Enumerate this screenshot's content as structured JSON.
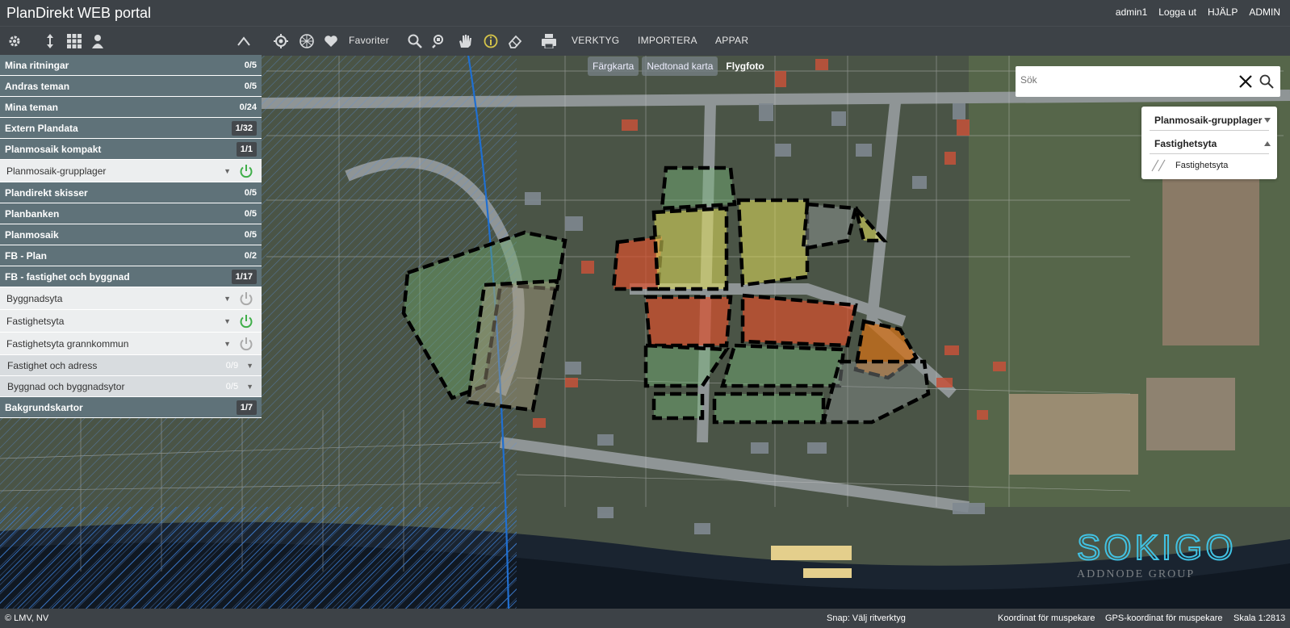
{
  "header": {
    "title": "PlanDirekt WEB portal",
    "links": [
      "admin1",
      "Logga ut",
      "HJÄLP",
      "ADMIN"
    ]
  },
  "toolbar": {
    "favoriter": "Favoriter",
    "verktyg": "VERKTYG",
    "importera": "IMPORTERA",
    "appar": "APPAR",
    "icons": [
      "gear-icon",
      "pan-icon",
      "grid-icon",
      "user-location-icon",
      "collapse-icon",
      "locate-icon",
      "globe-icon",
      "heart-icon",
      "search-icon",
      "search-map-icon",
      "hand-icon",
      "info-icon",
      "eraser-icon",
      "print-icon"
    ]
  },
  "map": {
    "tabs": [
      "Färgkarta",
      "Nedtonad karta",
      "Flygfoto"
    ],
    "active_tab": "Flygfoto",
    "search_placeholder": "Sök"
  },
  "layer_panel": {
    "group": "Planmosaik-grupplager",
    "layer": "Fastighetsyta",
    "legend": "Fastighetsyta"
  },
  "sidebar": {
    "rows": [
      {
        "label": "Mina ritningar",
        "count": "0/5",
        "kind": "dark"
      },
      {
        "label": "Andras teman",
        "count": "0/5",
        "kind": "dark"
      },
      {
        "label": "Mina teman",
        "count": "0/24",
        "kind": "dark"
      },
      {
        "label": "Extern Plandata",
        "count": "1/32",
        "kind": "dark-badge"
      },
      {
        "label": "Planmosaik kompakt",
        "count": "1/1",
        "kind": "dark-badge"
      },
      {
        "label": "Planmosaik-grupplager",
        "kind": "light",
        "power": "on"
      },
      {
        "label": "Plandirekt skisser",
        "count": "0/5",
        "kind": "dark"
      },
      {
        "label": "Planbanken",
        "count": "0/5",
        "kind": "dark"
      },
      {
        "label": "Planmosaik",
        "count": "0/5",
        "kind": "dark"
      },
      {
        "label": "FB - Plan",
        "count": "0/2",
        "kind": "dark"
      },
      {
        "label": "FB - fastighet och byggnad",
        "count": "1/17",
        "kind": "dark-badge"
      },
      {
        "label": "Byggnadsyta",
        "kind": "light",
        "power": "off"
      },
      {
        "label": "Fastighetsyta",
        "kind": "light",
        "power": "on"
      },
      {
        "label": "Fastighetsyta grannkommun",
        "kind": "light",
        "power": "off"
      },
      {
        "label": "Fastighet och adress",
        "count": "0/9",
        "kind": "grey"
      },
      {
        "label": "Byggnad och byggnadsytor",
        "count": "0/5",
        "kind": "grey"
      },
      {
        "label": "Bakgrundskartor",
        "count": "1/7",
        "kind": "dark-badge"
      }
    ]
  },
  "status": {
    "attribution": "© LMV, NV",
    "snap": "Snap: Välj ritverktyg",
    "coord": "Koordinat för muspekare",
    "gps": "GPS-koordinat för muspekare",
    "scale": "Skala 1:2813"
  },
  "logo": {
    "name": "SOKIGO",
    "sub": "ADDNODE GROUP"
  },
  "colors": {
    "accent_green": "#3fae49",
    "panel_dark": "#5f7279",
    "boundary_blue": "#1f6fd1"
  }
}
